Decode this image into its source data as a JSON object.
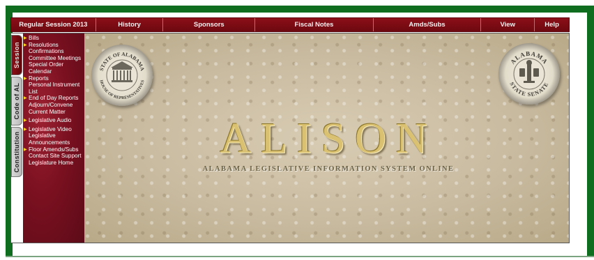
{
  "nav": {
    "items": [
      {
        "label": "Regular Session 2013"
      },
      {
        "label": "History"
      },
      {
        "label": "Sponsors"
      },
      {
        "label": "Fiscal Notes"
      },
      {
        "label": "Amds/Subs"
      },
      {
        "label": "View"
      },
      {
        "label": "Help"
      }
    ]
  },
  "tabs": {
    "session": "Session",
    "code_of_al": "Code of AL",
    "constitution": "Constitution"
  },
  "sidebar": {
    "items": [
      {
        "label": "Bills",
        "submenu": true
      },
      {
        "label": "Resolutions",
        "submenu": true
      },
      {
        "label": "Confirmations",
        "submenu": false
      },
      {
        "label": "Committee Meetings",
        "submenu": false
      },
      {
        "label": "Special Order Calendar",
        "submenu": false
      },
      {
        "label": "Reports",
        "submenu": true
      },
      {
        "label": "Personal Instrument List",
        "submenu": false
      },
      {
        "label": "End of Day Reports",
        "submenu": true
      },
      {
        "label": "Adjourn/Convene",
        "submenu": false
      },
      {
        "label": "Current Matter",
        "submenu": false
      },
      {
        "label": "Legislative Audio",
        "submenu": true
      },
      {
        "label": "Legislative Video",
        "submenu": true
      },
      {
        "label": "Legislative Announcements",
        "submenu": false
      },
      {
        "label": "Floor Amends/Subs",
        "submenu": true
      },
      {
        "label": "Contact Site Support",
        "submenu": false
      },
      {
        "label": "Legislature Home",
        "submenu": false
      }
    ]
  },
  "main": {
    "logo": "ALISON",
    "tagline": "ALABAMA LEGISLATIVE INFORMATION SYSTEM ONLINE",
    "house_seal_top": "STATE OF ALABAMA",
    "house_seal_bottom": "HOUSE OF REPRESENTATIVES",
    "senate_seal_top": "ALABAMA",
    "senate_seal_bottom": "STATE SENATE"
  },
  "colors": {
    "frame": "#0e6d1e",
    "nav_bg": "#7a0a12",
    "sidebar_bg": "#7a1020",
    "arrow": "#ffd21c",
    "logo_gold": "#d9c171"
  }
}
